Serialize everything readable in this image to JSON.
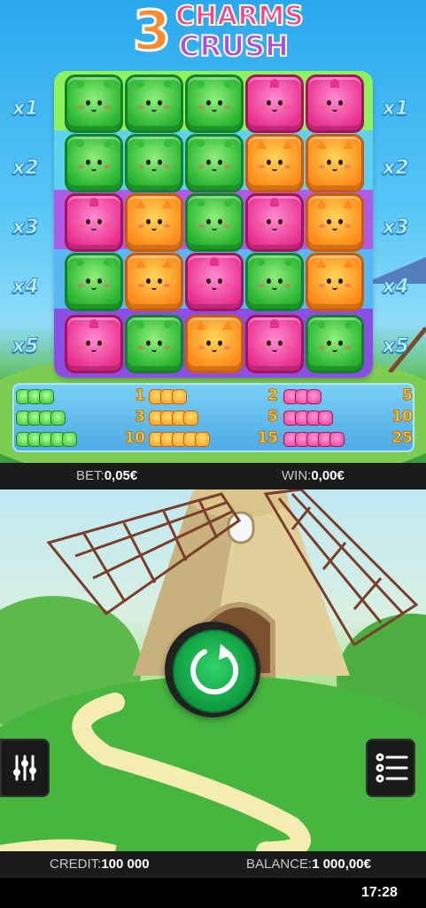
{
  "logo": {
    "number": "3",
    "word1": "CHARMS",
    "word2": "CRUSH"
  },
  "multipliers": [
    "x1",
    "x2",
    "x3",
    "x4",
    "x5"
  ],
  "grid": [
    [
      "green",
      "green",
      "green",
      "pink",
      "pink"
    ],
    [
      "green",
      "green",
      "green",
      "orange",
      "orange"
    ],
    [
      "pink",
      "orange",
      "green",
      "pink",
      "orange"
    ],
    [
      "green",
      "orange",
      "pink",
      "green",
      "orange"
    ],
    [
      "pink",
      "green",
      "orange",
      "pink",
      "green"
    ]
  ],
  "paytable": {
    "green": [
      {
        "count": 3,
        "payout": "1"
      },
      {
        "count": 4,
        "payout": "3"
      },
      {
        "count": 5,
        "payout": "10"
      }
    ],
    "orange": [
      {
        "count": 3,
        "payout": "2"
      },
      {
        "count": 4,
        "payout": "5"
      },
      {
        "count": 5,
        "payout": "15"
      }
    ],
    "pink": [
      {
        "count": 3,
        "payout": "5"
      },
      {
        "count": 4,
        "payout": "10"
      },
      {
        "count": 5,
        "payout": "25"
      }
    ]
  },
  "info": {
    "bet_label": "BET:",
    "bet_value": "0,05€",
    "win_label": "WIN:",
    "win_value": "0,00€"
  },
  "footer": {
    "credit_label": "CREDIT:",
    "credit_value": "100 000",
    "balance_label": "BALANCE:",
    "balance_value": "1 000,00€"
  },
  "status": {
    "time": "17:28"
  },
  "icons": {
    "spin": "refresh-arrow-icon",
    "settings": "sliders-icon",
    "menu": "menu-list-icon"
  },
  "colors": {
    "green": "#2fbf3a",
    "orange": "#ff8a19",
    "pink": "#e8308f",
    "spin": "#15b04c"
  }
}
